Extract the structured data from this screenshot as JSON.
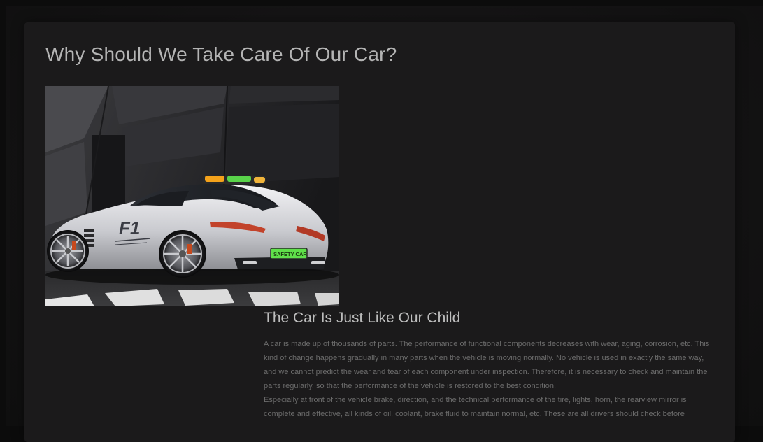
{
  "page": {
    "title": "Why Should We Take Care Of Our Car?"
  },
  "image": {
    "plate_text": "SAFETY CAR",
    "door_logo": "F1"
  },
  "article": {
    "heading": "The Car Is Just Like Our Child",
    "paragraphs": [
      "A car is made up of thousands of parts. The performance of functional components decreases with wear, aging, corrosion, etc. This kind of change happens gradually in many parts when the vehicle is moving normally. No vehicle is used in exactly the same way, and we cannot predict the wear and tear of each component under inspection. Therefore, it is necessary to check and maintain the parts regularly, so that the performance of the vehicle is restored to the best condition.",
      "Especially at front of the vehicle brake, direction, and the technical performance of the tire, lights, horn, the rearview mirror is complete and effective, all kinds of oil, coolant, brake fluid to maintain normal, etc. These are all drivers should check before"
    ]
  },
  "colors": {
    "page_background": "#0c0c0c",
    "card_background": "#1b1a1b",
    "title_text": "#b4b4b4",
    "body_text": "#6b6b6b"
  }
}
